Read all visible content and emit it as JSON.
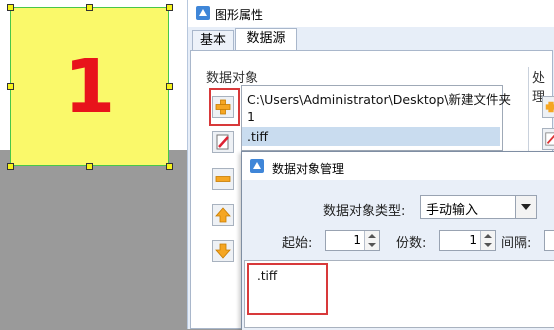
{
  "canvas": {
    "shape_text": "1",
    "colors": {
      "fill": "#faf96a",
      "border": "#48c64a",
      "text": "#e8131b"
    }
  },
  "props_window": {
    "title": "图形属性",
    "tabs": [
      {
        "label": "基本"
      },
      {
        "label": "数据源"
      }
    ],
    "data_object_group_label": "数据对象",
    "process_group_label": "处理",
    "list_items": [
      {
        "text": "C:\\Users\\Administrator\\Desktop\\新建文件夹"
      },
      {
        "text": "1"
      },
      {
        "text": ".tiff"
      }
    ]
  },
  "side_buttons": {
    "icons": [
      "add-icon",
      "edit-icon",
      "remove-icon",
      "move-up-icon",
      "move-down-icon"
    ]
  },
  "dialog": {
    "title": "数据对象管理",
    "type_label": "数据对象类型:",
    "type_value": "手动输入",
    "start_label": "起始:",
    "start_value": "1",
    "copies_label": "份数:",
    "copies_value": "1",
    "interval_label": "间隔:",
    "content": ".tiff"
  },
  "accent_colors": {
    "highlight_box": "#d8393a",
    "selected_row": "#c9dcef"
  }
}
